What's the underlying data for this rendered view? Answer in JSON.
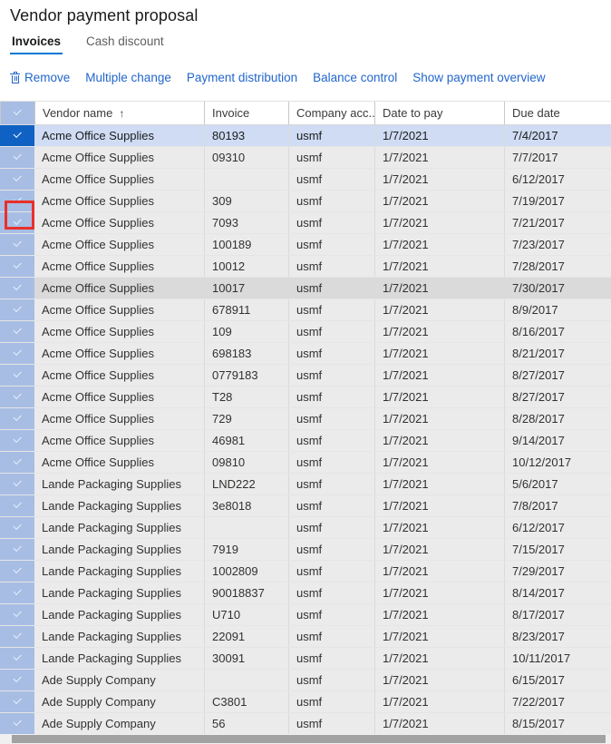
{
  "page": {
    "title": "Vendor payment proposal"
  },
  "tabs": [
    {
      "label": "Invoices",
      "active": true
    },
    {
      "label": "Cash discount",
      "active": false
    }
  ],
  "toolbar": {
    "items": [
      {
        "label": "Remove",
        "icon": "trash-icon"
      },
      {
        "label": "Multiple change",
        "icon": null
      },
      {
        "label": "Payment distribution",
        "icon": null
      },
      {
        "label": "Balance control",
        "icon": null
      },
      {
        "label": "Show payment overview",
        "icon": null
      }
    ]
  },
  "grid": {
    "select_all_checked": true,
    "columns": [
      {
        "key": "check",
        "label": ""
      },
      {
        "key": "vendor",
        "label": "Vendor name",
        "sort": "↑"
      },
      {
        "key": "invoice",
        "label": "Invoice"
      },
      {
        "key": "company",
        "label": "Company acc..."
      },
      {
        "key": "datepay",
        "label": "Date to pay"
      },
      {
        "key": "duedate",
        "label": "Due date"
      }
    ],
    "rows": [
      {
        "checked": true,
        "vendor": "Acme Office Supplies",
        "invoice": "80193",
        "company": "usmf",
        "datepay": "1/7/2021",
        "duedate": "7/4/2017",
        "state": "selected"
      },
      {
        "checked": true,
        "vendor": "Acme Office Supplies",
        "invoice": "09310",
        "company": "usmf",
        "datepay": "1/7/2021",
        "duedate": "7/7/2017",
        "state": ""
      },
      {
        "checked": true,
        "vendor": "Acme Office Supplies",
        "invoice": "",
        "company": "usmf",
        "datepay": "1/7/2021",
        "duedate": "6/12/2017",
        "state": ""
      },
      {
        "checked": true,
        "vendor": "Acme Office Supplies",
        "invoice": "309",
        "company": "usmf",
        "datepay": "1/7/2021",
        "duedate": "7/19/2017",
        "state": ""
      },
      {
        "checked": true,
        "vendor": "Acme Office Supplies",
        "invoice": "7093",
        "company": "usmf",
        "datepay": "1/7/2021",
        "duedate": "7/21/2017",
        "state": ""
      },
      {
        "checked": true,
        "vendor": "Acme Office Supplies",
        "invoice": "100189",
        "company": "usmf",
        "datepay": "1/7/2021",
        "duedate": "7/23/2017",
        "state": ""
      },
      {
        "checked": true,
        "vendor": "Acme Office Supplies",
        "invoice": "10012",
        "company": "usmf",
        "datepay": "1/7/2021",
        "duedate": "7/28/2017",
        "state": ""
      },
      {
        "checked": true,
        "vendor": "Acme Office Supplies",
        "invoice": "10017",
        "company": "usmf",
        "datepay": "1/7/2021",
        "duedate": "7/30/2017",
        "state": "hover"
      },
      {
        "checked": true,
        "vendor": "Acme Office Supplies",
        "invoice": "678911",
        "company": "usmf",
        "datepay": "1/7/2021",
        "duedate": "8/9/2017",
        "state": ""
      },
      {
        "checked": true,
        "vendor": "Acme Office Supplies",
        "invoice": "109",
        "company": "usmf",
        "datepay": "1/7/2021",
        "duedate": "8/16/2017",
        "state": ""
      },
      {
        "checked": true,
        "vendor": "Acme Office Supplies",
        "invoice": "698183",
        "company": "usmf",
        "datepay": "1/7/2021",
        "duedate": "8/21/2017",
        "state": ""
      },
      {
        "checked": true,
        "vendor": "Acme Office Supplies",
        "invoice": "0779183",
        "company": "usmf",
        "datepay": "1/7/2021",
        "duedate": "8/27/2017",
        "state": ""
      },
      {
        "checked": true,
        "vendor": "Acme Office Supplies",
        "invoice": "T28",
        "company": "usmf",
        "datepay": "1/7/2021",
        "duedate": "8/27/2017",
        "state": ""
      },
      {
        "checked": true,
        "vendor": "Acme Office Supplies",
        "invoice": "729",
        "company": "usmf",
        "datepay": "1/7/2021",
        "duedate": "8/28/2017",
        "state": ""
      },
      {
        "checked": true,
        "vendor": "Acme Office Supplies",
        "invoice": "46981",
        "company": "usmf",
        "datepay": "1/7/2021",
        "duedate": "9/14/2017",
        "state": ""
      },
      {
        "checked": true,
        "vendor": "Acme Office Supplies",
        "invoice": "09810",
        "company": "usmf",
        "datepay": "1/7/2021",
        "duedate": "10/12/2017",
        "state": ""
      },
      {
        "checked": true,
        "vendor": "Lande Packaging Supplies",
        "invoice": "LND222",
        "company": "usmf",
        "datepay": "1/7/2021",
        "duedate": "5/6/2017",
        "state": ""
      },
      {
        "checked": true,
        "vendor": "Lande Packaging Supplies",
        "invoice": "3e8018",
        "company": "usmf",
        "datepay": "1/7/2021",
        "duedate": "7/8/2017",
        "state": ""
      },
      {
        "checked": true,
        "vendor": "Lande Packaging Supplies",
        "invoice": "",
        "company": "usmf",
        "datepay": "1/7/2021",
        "duedate": "6/12/2017",
        "state": ""
      },
      {
        "checked": true,
        "vendor": "Lande Packaging Supplies",
        "invoice": "7919",
        "company": "usmf",
        "datepay": "1/7/2021",
        "duedate": "7/15/2017",
        "state": ""
      },
      {
        "checked": true,
        "vendor": "Lande Packaging Supplies",
        "invoice": "1002809",
        "company": "usmf",
        "datepay": "1/7/2021",
        "duedate": "7/29/2017",
        "state": ""
      },
      {
        "checked": true,
        "vendor": "Lande Packaging Supplies",
        "invoice": "90018837",
        "company": "usmf",
        "datepay": "1/7/2021",
        "duedate": "8/14/2017",
        "state": ""
      },
      {
        "checked": true,
        "vendor": "Lande Packaging Supplies",
        "invoice": "U710",
        "company": "usmf",
        "datepay": "1/7/2021",
        "duedate": "8/17/2017",
        "state": ""
      },
      {
        "checked": true,
        "vendor": "Lande Packaging Supplies",
        "invoice": "22091",
        "company": "usmf",
        "datepay": "1/7/2021",
        "duedate": "8/23/2017",
        "state": ""
      },
      {
        "checked": true,
        "vendor": "Lande Packaging Supplies",
        "invoice": "30091",
        "company": "usmf",
        "datepay": "1/7/2021",
        "duedate": "10/11/2017",
        "state": ""
      },
      {
        "checked": true,
        "vendor": "Ade Supply Company",
        "invoice": "",
        "company": "usmf",
        "datepay": "1/7/2021",
        "duedate": "6/15/2017",
        "state": ""
      },
      {
        "checked": true,
        "vendor": "Ade Supply Company",
        "invoice": "C3801",
        "company": "usmf",
        "datepay": "1/7/2021",
        "duedate": "7/22/2017",
        "state": ""
      },
      {
        "checked": true,
        "vendor": "Ade Supply Company",
        "invoice": "56",
        "company": "usmf",
        "datepay": "1/7/2021",
        "duedate": "8/15/2017",
        "state": ""
      }
    ]
  },
  "annotation": {
    "target": "select-all-checkbox",
    "color": "#e8302a"
  },
  "colors": {
    "link": "#2266cc",
    "tab_accent": "#0078d4",
    "selected_row": "#cfdcf4",
    "checkbox_column": "#a7bde4",
    "checkbox_selected": "#0f62c4",
    "row_background": "#ebebeb",
    "row_hover": "#dadada"
  }
}
